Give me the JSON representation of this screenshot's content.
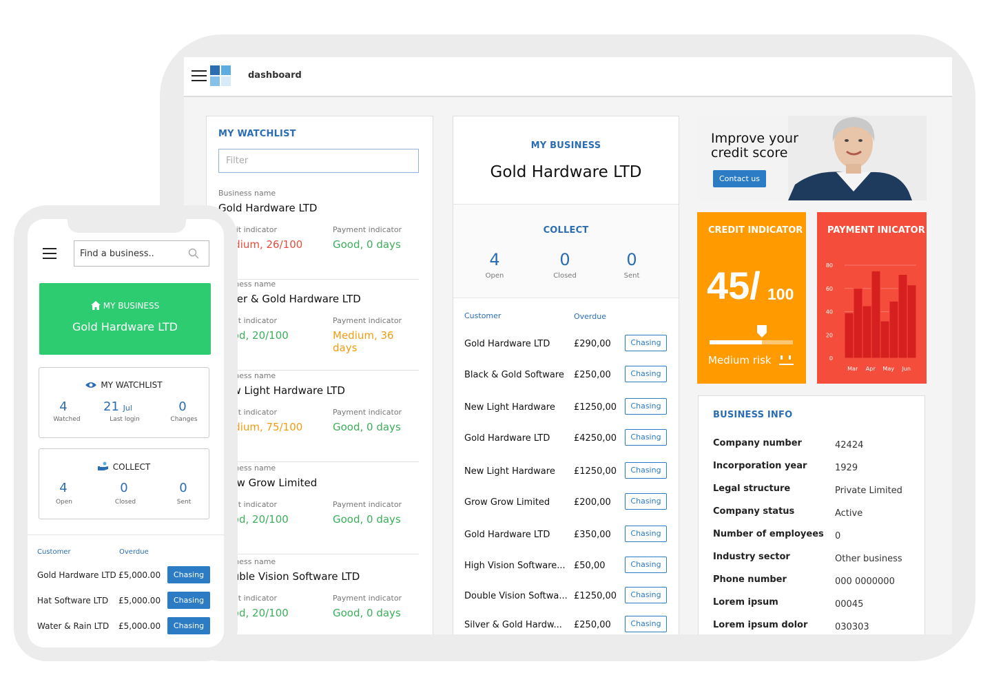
{
  "tablet": {
    "title": "dashboard",
    "watchlist": {
      "title": "MY WATCHLIST",
      "filter_placeholder": "Filter",
      "business_label": "Business name",
      "credit_label": "Credit indicator",
      "payment_label": "Payment indicator",
      "items": [
        {
          "name": "Gold Hardware LTD",
          "credit": "Medium, 26/100",
          "credit_color": "#e74c3c",
          "payment": "Good, 0 days",
          "payment_color": "#3cae5b"
        },
        {
          "name": "Silver & Gold Hardware LTD",
          "credit": "Good, 20/100",
          "credit_color": "#3cae5b",
          "payment": "Medium, 36 days",
          "payment_color": "#f39c12"
        },
        {
          "name": "New Light Hardware LTD",
          "credit": "Medium, 75/100",
          "credit_color": "#f39c12",
          "payment": "Good, 0 days",
          "payment_color": "#3cae5b"
        },
        {
          "name": "Grow Grow Limited",
          "credit": "Good, 20/100",
          "credit_color": "#3cae5b",
          "payment": "Good, 0 days",
          "payment_color": "#3cae5b"
        },
        {
          "name": "Double Vision Software LTD",
          "credit": "Good, 20/100",
          "credit_color": "#3cae5b",
          "payment": "Good, 0 days",
          "payment_color": "#3cae5b"
        }
      ]
    },
    "business": {
      "title": "MY BUSINESS",
      "name": "Gold Hardware LTD",
      "collect_title": "COLLECT",
      "stats": [
        {
          "value": "4",
          "label": "Open"
        },
        {
          "value": "0",
          "label": "Closed"
        },
        {
          "value": "0",
          "label": "Sent"
        }
      ],
      "col_customer": "Customer",
      "col_overdue": "Overdue",
      "rows": [
        {
          "customer": "Gold Hardware LTD",
          "amount": "£290,00",
          "action": "Chasing"
        },
        {
          "customer": "Black & Gold Software",
          "amount": "£250,00",
          "action": "Chasing"
        },
        {
          "customer": "New Light Hardware",
          "amount": "£1250,00",
          "action": "Chasing"
        },
        {
          "customer": "Gold Hardware LTD",
          "amount": "£4250,00",
          "action": "Chasing"
        },
        {
          "customer": "New Light Hardware",
          "amount": "£1250,00",
          "action": "Chasing"
        },
        {
          "customer": "Grow Grow Limited",
          "amount": "£200,00",
          "action": "Chasing"
        },
        {
          "customer": "Gold Hardware LTD",
          "amount": "£350,00",
          "action": "Chasing"
        },
        {
          "customer": "High Vision Software...",
          "amount": "£50,00",
          "action": "Chasing"
        },
        {
          "customer": "Double Vision Softwa...",
          "amount": "£1250,00",
          "action": "Chasing"
        },
        {
          "customer": "Silver & Gold Hardw...",
          "amount": "£250,00",
          "action": "Chasing"
        }
      ]
    },
    "promo": {
      "headline_line1": "Improve your",
      "headline_line2": "credit score",
      "button": "Contact us"
    },
    "credit_indicator": {
      "title": "CREDIT INDICATOR",
      "score": "45/",
      "max": "100",
      "risk": "Medium risk",
      "level_fraction": 0.45,
      "color": "#ff9a00"
    },
    "payment_indicator": {
      "title": "PAYMENT INICATOR",
      "color": "#f54d3b"
    },
    "business_info": {
      "title": "BUSINESS INFO",
      "rows": [
        {
          "key": "Company number",
          "value": "42424"
        },
        {
          "key": "Incorporation year",
          "value": "1929"
        },
        {
          "key": "Legal structure",
          "value": "Private Limited"
        },
        {
          "key": "Company status",
          "value": "Active"
        },
        {
          "key": "Number of employees",
          "value": "0"
        },
        {
          "key": "Industry sector",
          "value": "Other business"
        },
        {
          "key": "Phone number",
          "value": "000 0000000"
        },
        {
          "key": "Lorem ipsum",
          "value": "00045"
        },
        {
          "key": "Lorem ipsum dolor",
          "value": "030303"
        }
      ]
    }
  },
  "phone": {
    "search_placeholder": "Find a business..",
    "my_business_label": "MY BUSINESS",
    "my_business_name": "Gold Hardware LTD",
    "watchlist_title": "MY WATCHLIST",
    "watchlist_stats": [
      {
        "value": "4",
        "unit": "",
        "label": "Watched"
      },
      {
        "value": "21",
        "unit": "Jul",
        "label": "Last login"
      },
      {
        "value": "0",
        "unit": "",
        "label": "Changes"
      }
    ],
    "collect_title": "COLLECT",
    "collect_stats": [
      {
        "value": "4",
        "label": "Open"
      },
      {
        "value": "0",
        "label": "Closed"
      },
      {
        "value": "0",
        "label": "Sent"
      }
    ],
    "col_customer": "Customer",
    "col_overdue": "Overdue",
    "rows": [
      {
        "customer": "Gold Hardware LTD",
        "amount": "£5,000.00",
        "action": "Chasing"
      },
      {
        "customer": "Hat Software LTD",
        "amount": "£5,000.00",
        "action": "Chasing"
      },
      {
        "customer": "Water & Rain LTD",
        "amount": "£5,000.00",
        "action": "Chasing"
      }
    ],
    "green": "#2ecc71",
    "accent": "#2b6db3"
  },
  "chart_data": {
    "type": "bar",
    "categories": [
      "Mar",
      "",
      "Apr",
      "",
      "May",
      "",
      "Jun",
      ""
    ],
    "values": [
      39,
      60,
      45,
      75,
      32,
      49,
      72,
      63
    ],
    "ylim": [
      0,
      80
    ],
    "yticks": [
      "0",
      "20",
      "40",
      "60",
      "80"
    ],
    "grid": true,
    "xlabel": "",
    "ylabel": ""
  }
}
